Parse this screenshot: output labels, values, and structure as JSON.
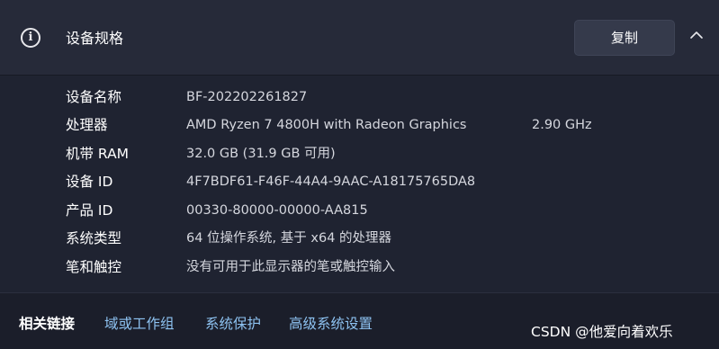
{
  "header": {
    "title": "设备规格",
    "copy_label": "复制",
    "info_icon": "info-icon",
    "collapse_icon": "chevron-up-icon"
  },
  "specs": [
    {
      "label": "设备名称",
      "value": "BF-202202261827",
      "extra": ""
    },
    {
      "label": "处理器",
      "value": "AMD Ryzen 7 4800H with Radeon Graphics",
      "extra": "2.90 GHz"
    },
    {
      "label": "机带 RAM",
      "value": "32.0 GB (31.9 GB 可用)",
      "extra": ""
    },
    {
      "label": "设备 ID",
      "value": "4F7BDF61-F46F-44A4-9AAC-A18175765DA8",
      "extra": ""
    },
    {
      "label": "产品 ID",
      "value": "00330-80000-00000-AA815",
      "extra": ""
    },
    {
      "label": "系统类型",
      "value": "64 位操作系统, 基于 x64 的处理器",
      "extra": ""
    },
    {
      "label": "笔和触控",
      "value": "没有可用于此显示器的笔或触控输入",
      "extra": ""
    }
  ],
  "footer": {
    "label": "相关链接",
    "links": [
      "域或工作组",
      "系统保护",
      "高级系统设置"
    ]
  },
  "watermark": "CSDN @他爱向着欢乐",
  "colors": {
    "background": "#1d2130",
    "header": "#262a39",
    "link": "#8ec3f2",
    "button": "#353a4b"
  }
}
